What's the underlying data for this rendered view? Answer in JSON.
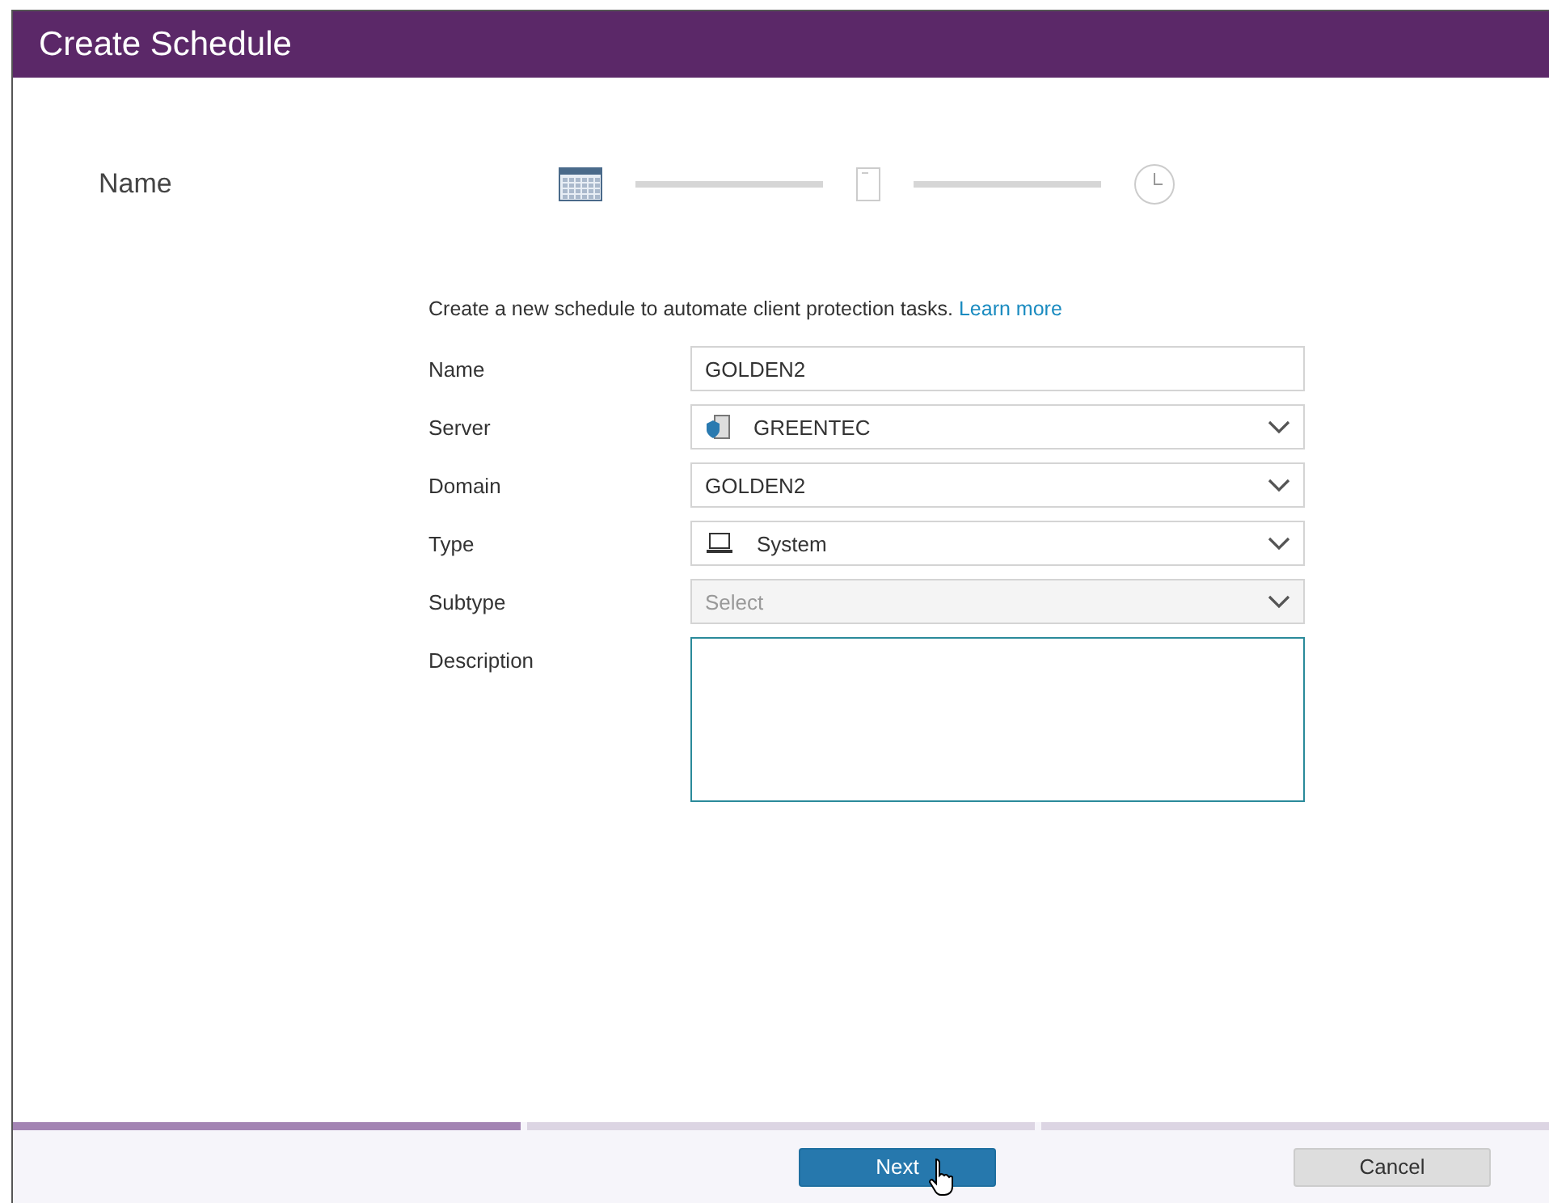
{
  "window": {
    "title": "Create Schedule"
  },
  "step_title": "Name",
  "steps": [
    {
      "kind": "calendar",
      "selected": true
    },
    {
      "kind": "document",
      "selected": false
    },
    {
      "kind": "clock",
      "selected": false
    }
  ],
  "intro": {
    "text": "Create a new schedule to automate client protection tasks.",
    "link": "Learn more"
  },
  "fields": [
    {
      "label": "Name",
      "kind": "text",
      "value": "GOLDEN2",
      "disabled": false
    },
    {
      "label": "Server",
      "kind": "server-select",
      "value": "GREENTEC",
      "disabled": false
    },
    {
      "label": "Domain",
      "kind": "select",
      "value": "GOLDEN2",
      "disabled": false
    },
    {
      "label": "Type",
      "kind": "laptop-select",
      "value": "System",
      "disabled": false
    },
    {
      "label": "Subtype",
      "kind": "select",
      "placeholder": "Select",
      "disabled": true
    },
    {
      "label": "Description",
      "kind": "textarea",
      "focused": true
    }
  ],
  "progress": [
    {
      "selected": true
    },
    {
      "selected": false
    },
    {
      "selected": false
    }
  ],
  "buttons": [
    {
      "label": "Next",
      "kind": "primary"
    },
    {
      "label": "Cancel",
      "kind": "secondary"
    }
  ]
}
